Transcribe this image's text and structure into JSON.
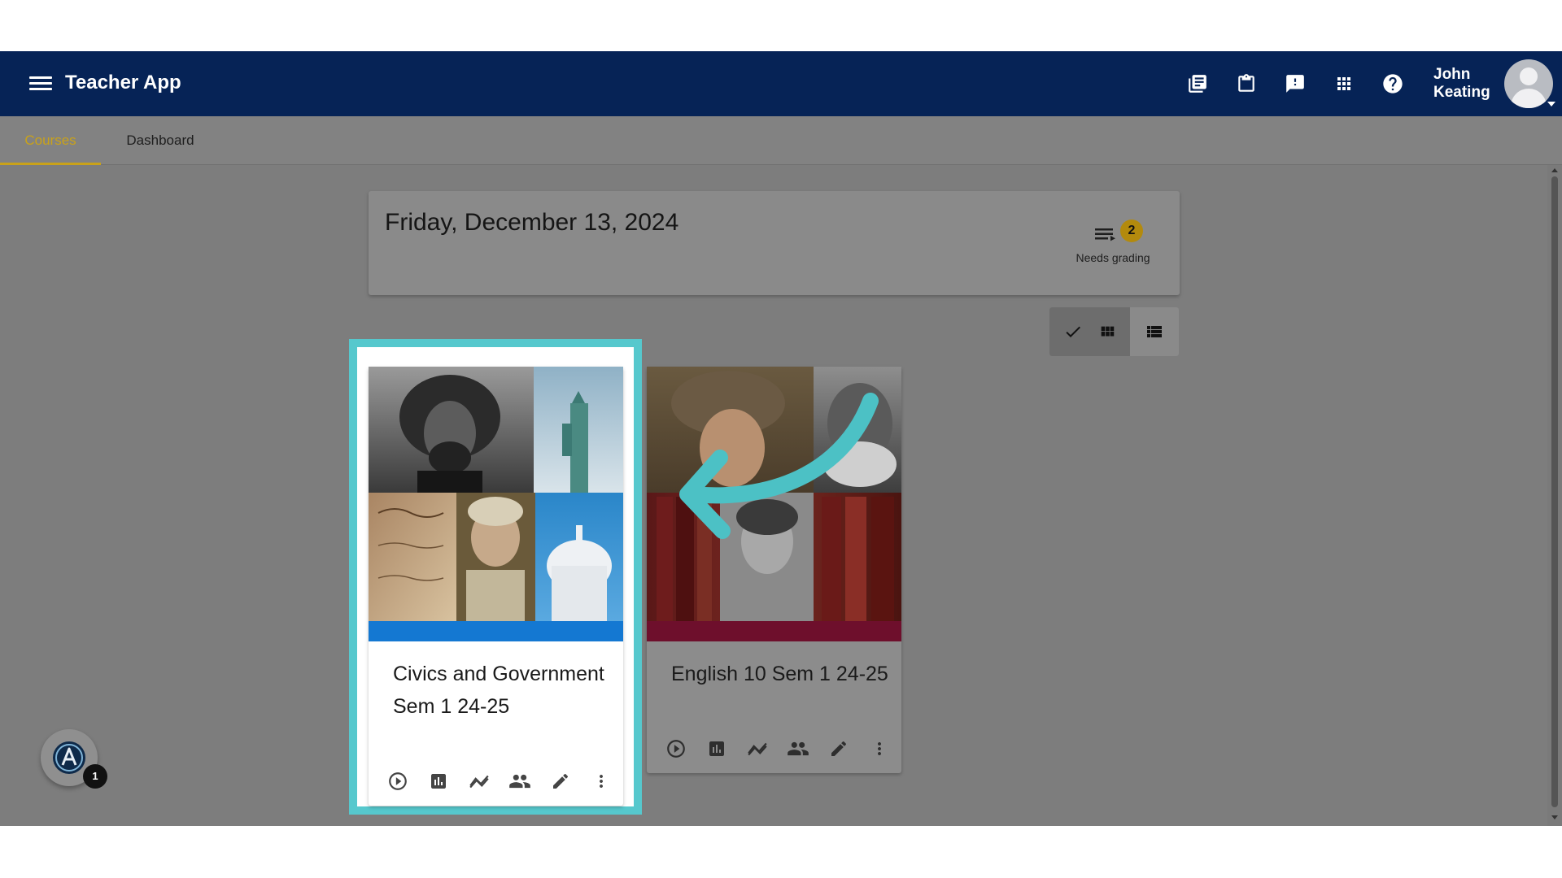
{
  "app": {
    "title": "Teacher App"
  },
  "header": {
    "icons": [
      "library-books-icon",
      "clipboard-icon",
      "feedback-icon",
      "apps-grid-icon",
      "help-icon"
    ],
    "user_first": "John",
    "user_last": "Keating"
  },
  "tabs": [
    {
      "label": "Courses",
      "active": true
    },
    {
      "label": "Dashboard",
      "active": false
    }
  ],
  "date_card": {
    "date": "Friday, December 13, 2024",
    "needs_grading_count": "2",
    "needs_grading_label": "Needs grading"
  },
  "view_toggle": {
    "selected": "grid",
    "options": [
      "grid",
      "list"
    ]
  },
  "courses": [
    {
      "title": "Civics and Government Sem 1 24-25",
      "strip_color": "#1478d2",
      "selected": true
    },
    {
      "title": "English 10 Sem 1 24-25",
      "strip_color": "#6e0f2c",
      "selected": false
    }
  ],
  "card_actions": [
    "play-icon",
    "bar-chart-icon",
    "trend-icon",
    "people-icon",
    "edit-icon",
    "more-vert-icon"
  ],
  "fab": {
    "badge": "1"
  },
  "colors": {
    "appbar": "#062356",
    "accent": "#c9a21a",
    "highlight": "#56c8cd",
    "arrow": "#4cc1c5"
  }
}
